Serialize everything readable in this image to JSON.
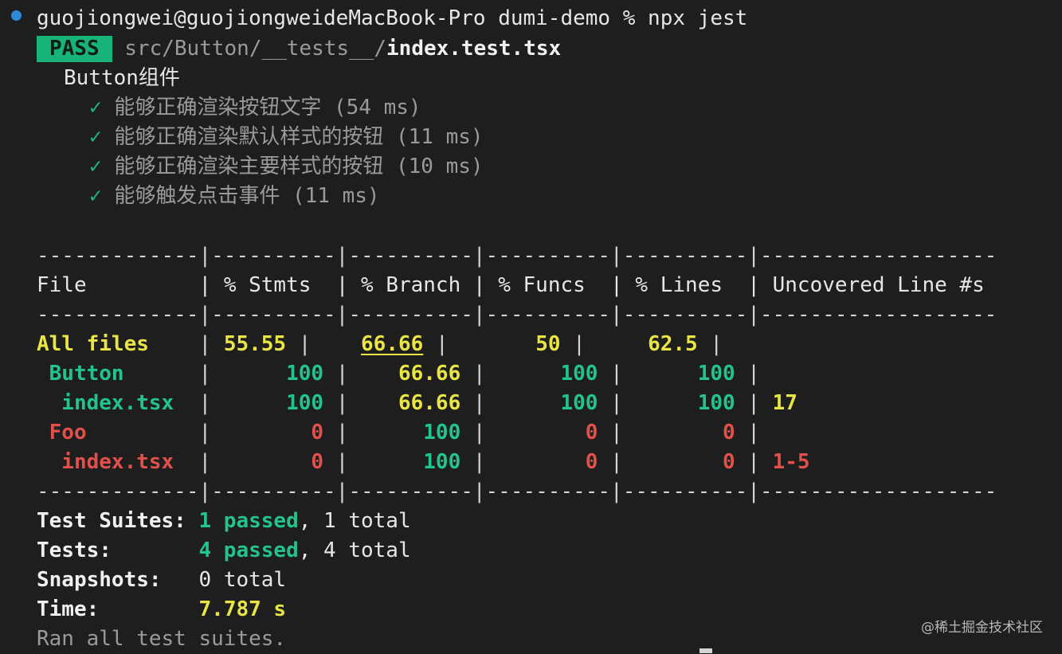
{
  "prompt": {
    "user_host": "guojiongwei@guojiongweideMacBook-Pro",
    "directory": "dumi-demo",
    "symbol": "%",
    "command": "npx jest"
  },
  "result": {
    "badge": "PASS",
    "path_dir": "src/Button/__tests__/",
    "path_file": "index.test.tsx"
  },
  "suite": {
    "name": "Button组件",
    "check_mark": "✓",
    "tests": [
      {
        "name": "能够正确渲染按钮文字",
        "duration": "(54 ms)"
      },
      {
        "name": "能够正确渲染默认样式的按钮",
        "duration": "(11 ms)"
      },
      {
        "name": "能够正确渲染主要样式的按钮",
        "duration": "(10 ms)"
      },
      {
        "name": "能够触发点击事件",
        "duration": "(11 ms)"
      }
    ]
  },
  "coverage": {
    "divider": "-------------|----------|----------|----------|----------|-------------------",
    "headers": [
      "File",
      "% Stmts",
      "% Branch",
      "% Funcs",
      "% Lines",
      "Uncovered Line #s"
    ],
    "rows": [
      {
        "file": "All files",
        "stmts": "55.55",
        "branch": "66.66",
        "funcs": "50",
        "lines": "62.5",
        "uncovered": ""
      },
      {
        "file": " Button",
        "stmts": "100",
        "branch": "66.66",
        "funcs": "100",
        "lines": "100",
        "uncovered": ""
      },
      {
        "file": "  index.tsx",
        "stmts": "100",
        "branch": "66.66",
        "funcs": "100",
        "lines": "100",
        "uncovered": "17"
      },
      {
        "file": " Foo",
        "stmts": "0",
        "branch": "100",
        "funcs": "0",
        "lines": "0",
        "uncovered": ""
      },
      {
        "file": "  index.tsx",
        "stmts": "0",
        "branch": "100",
        "funcs": "0",
        "lines": "0",
        "uncovered": "1-5"
      }
    ]
  },
  "summary": {
    "suites_label": "Test Suites:",
    "suites_passed": "1 passed",
    "suites_total": ", 1 total",
    "tests_label": "Tests:",
    "tests_passed": "4 passed",
    "tests_total": ", 4 total",
    "snapshots_label": "Snapshots:",
    "snapshots_value": "0 total",
    "time_label": "Time:",
    "time_value": "7.787 s",
    "footer": "Ran all test suites."
  },
  "watermark": "@稀土掘金技术社区",
  "colors": {
    "background": "#1e1e1e",
    "pass": "#23c38f",
    "warn": "#e9e544",
    "fail": "#e2504c",
    "prompt_dot": "#2f89d8"
  }
}
